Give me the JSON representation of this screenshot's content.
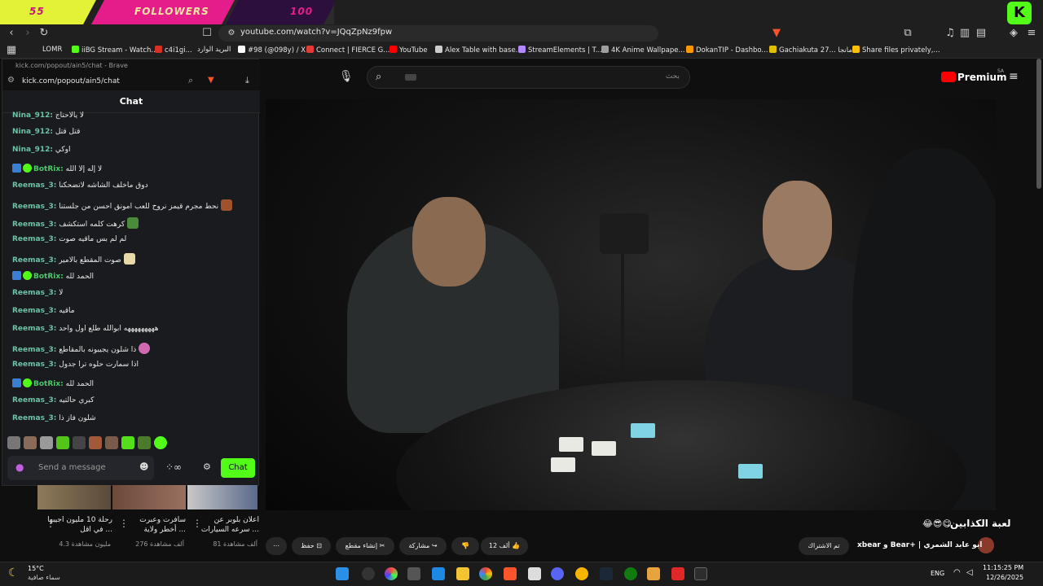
{
  "overlay": {
    "left": "55",
    "center": "FOLLOWERS",
    "right": "100"
  },
  "logo": {
    "kick": "K"
  },
  "browser": {
    "url": "youtube.com/watch?v=JQqZpNz9fpw",
    "bookmarks": [
      {
        "label": "LOMR",
        "color": "#888888"
      },
      {
        "label": "iiBG Stream - Watch...",
        "color": "#53fc18"
      },
      {
        "label": "c4i1gi...",
        "color": "#d93025"
      },
      {
        "label": "البريد الوارد",
        "color": "#ea4335"
      },
      {
        "label": "#98 (@098y) / X",
        "color": "#ffffff"
      },
      {
        "label": "Connect | FIERCE G...",
        "color": "#e53935"
      },
      {
        "label": "YouTube",
        "color": "#ff0000"
      },
      {
        "label": "Alex Table with base...",
        "color": "#cccccc"
      },
      {
        "label": "StreamElements | T...",
        "color": "#b388ff"
      },
      {
        "label": "4K Anime Wallpape...",
        "color": "#9e9e9e"
      },
      {
        "label": "DokanTIP - Dashbo...",
        "color": "#ff9800"
      },
      {
        "label": "Gachiakuta 27... مانجا",
        "color": "#e0c000"
      },
      {
        "label": "Share files privately,...",
        "color": "#ffc107"
      }
    ]
  },
  "popup": {
    "window_title": "kick.com/popout/ain5/chat - Brave",
    "url": "kick.com/popout/ain5/chat",
    "header": "Chat",
    "messages": [
      {
        "user": "Nina_912:",
        "text": "لا يالاحتاج",
        "badges": false
      },
      {
        "user": "Nina_912:",
        "text": "قتل قتل",
        "badges": false
      },
      {
        "user": "Nina_912:",
        "text": "اوكي",
        "badges": false
      },
      {
        "user": "BotRix:",
        "text": "لا إله إلا الله",
        "badges": true
      },
      {
        "user": "Reemas_3:",
        "text": "دوق ماخلف الشاشه لاتضحكنا",
        "badges": false
      },
      {
        "user": "Reemas_3:",
        "text": "نحط مجرم قيمز نروح للعب امونق احسن من جلستنا",
        "badges": false
      },
      {
        "user": "Reemas_3:",
        "text": "كرهت كلمه استكشف",
        "badges": false
      },
      {
        "user": "Reemas_3:",
        "text": "لم لم بس ماقيه صوت",
        "badges": false
      },
      {
        "user": "Reemas_3:",
        "text": "صوت المقطع بالامير",
        "badges": false
      },
      {
        "user": "BotRix:",
        "text": "الحمد لله",
        "badges": true
      },
      {
        "user": "Reemas_3:",
        "text": "لا",
        "badges": false
      },
      {
        "user": "Reemas_3:",
        "text": "ماقيه",
        "badges": false
      },
      {
        "user": "Reemas_3:",
        "text": "هههههههههه ابوالله طلع اول واحد",
        "badges": false
      },
      {
        "user": "Reemas_3:",
        "text": "ذا شلون يجيبونه بالمقاطع",
        "badges": false
      },
      {
        "user": "Reemas_3:",
        "text": "اذا سمارت حلوه ترا جدول",
        "badges": false
      },
      {
        "user": "BotRix:",
        "text": "الحمد لله",
        "badges": true
      },
      {
        "user": "Reemas_3:",
        "text": "كبري حالتيه",
        "badges": false
      },
      {
        "user": "Reemas_3:",
        "text": "شلون فاز ذا",
        "badges": false
      }
    ],
    "input_placeholder": "Send a message",
    "chat_button": "Chat",
    "colors": {
      "accent": "#53fc18",
      "username": "#4ec76d"
    }
  },
  "youtube": {
    "search_placeholder": "بحث",
    "premium": "Premium",
    "premium_region": "SA",
    "video_title": "لعبة الكذابين",
    "channel": "xbear و Bear+ | ابو عابد الشمري",
    "subscribe": "تم الاشتراك",
    "likes": "12 ألف",
    "share": "مشاركة",
    "clip": "إنشاء مقطع",
    "save": "حفظ",
    "recommendations": [
      {
        "title": "رحلة 10 مليون اجيبها في اقل ...",
        "views": "4.3 مليون مشاهدة"
      },
      {
        "title": "سافرت وعبرت أخطر ولاية ...",
        "views": "276 ألف مشاهدة"
      },
      {
        "title": "اعلان بلوبر عن سرعه السيارات ...",
        "views": "81 ألف مشاهدة"
      }
    ]
  },
  "taskbar": {
    "weather_temp": "15°C",
    "weather_text": "سماء صافية",
    "lang": "ENG",
    "time": "11:15:25 PM",
    "date": "12/26/2025"
  }
}
